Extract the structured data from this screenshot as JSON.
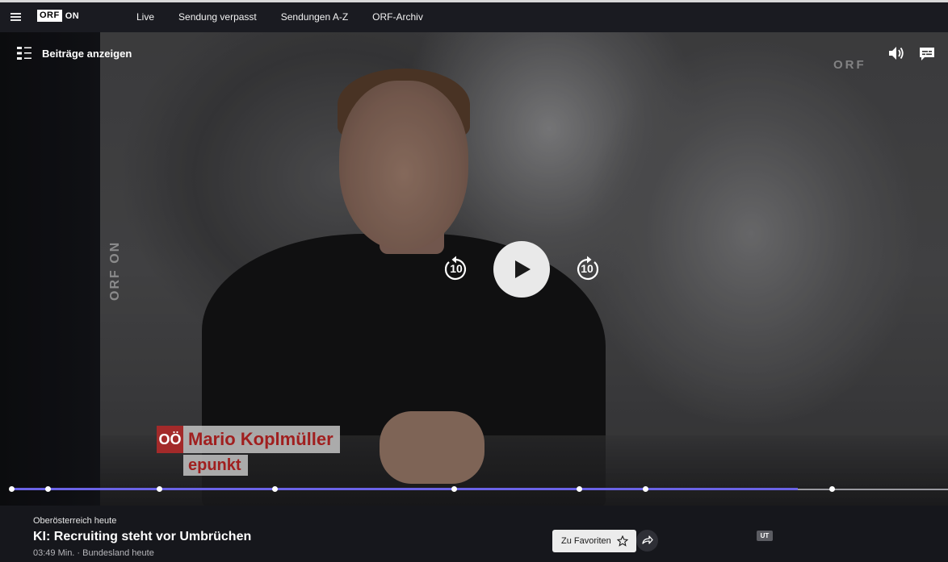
{
  "header": {
    "logo_box": "ORF",
    "logo_on": "ON",
    "nav": [
      "Live",
      "Sendung verpasst",
      "Sendungen A-Z",
      "ORF-Archiv"
    ]
  },
  "player": {
    "episodes_label": "Beiträge anzeigen",
    "watermark_side": "ORF ON",
    "watermark_top": "ORF",
    "skip_back_label": "10",
    "skip_forward_label": "10",
    "lower_third": {
      "logo": "OÖ",
      "name": "Mario Koplmüller",
      "subtitle": "epunkt"
    },
    "progress": {
      "played_fraction": 0.84,
      "chapter_markers": [
        0.0,
        0.039,
        0.158,
        0.281,
        0.472,
        0.606,
        0.677,
        0.876
      ]
    },
    "accent_color": "#6b63e6"
  },
  "info": {
    "show_name": "Oberösterreich heute",
    "title": "KI: Recruiting steht vor Umbrüchen",
    "meta": "03:49 Min. · Bundesland heute",
    "favorite_label": "Zu Favoriten",
    "subtitle_badge": "UT"
  }
}
